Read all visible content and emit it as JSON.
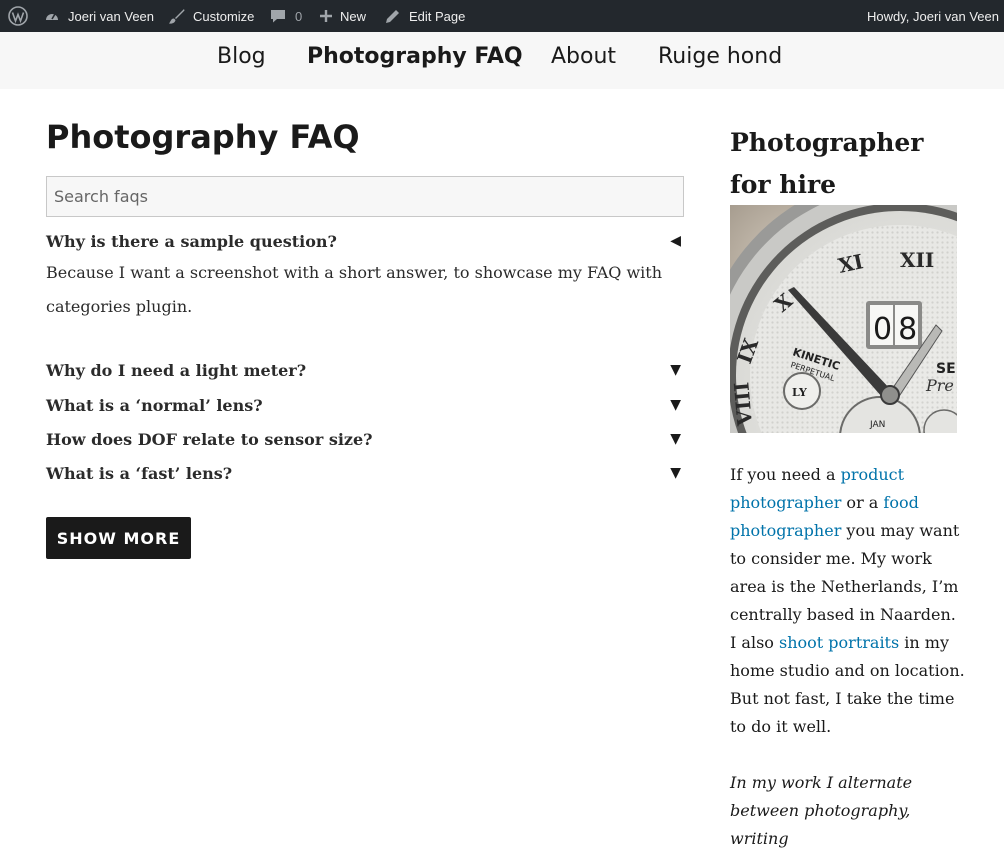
{
  "adminbar": {
    "site_name": "Joeri van Veen",
    "customize": "Customize",
    "comments_count": "0",
    "new": "New",
    "edit_page": "Edit Page",
    "howdy": "Howdy, Joeri van Veen",
    "icons": [
      "wordpress-logo-icon",
      "dashboard-icon",
      "paintbrush-icon",
      "comment-icon",
      "plus-icon",
      "pencil-icon"
    ],
    "background": "#23282d"
  },
  "nav": {
    "items": [
      {
        "label": "Blog"
      },
      {
        "label": "Photography FAQ",
        "active": true
      },
      {
        "label": "About"
      },
      {
        "label": "Ruige hond"
      }
    ]
  },
  "main": {
    "title": "Photography FAQ",
    "search_placeholder": "Search faqs",
    "faqs": [
      {
        "question": "Why is there a sample question?",
        "expanded": true,
        "icon": "◀",
        "answer": "Because I want a screenshot with a short answer, to showcase my FAQ with categories plugin."
      },
      {
        "question": "Why do I need a light meter?",
        "expanded": false,
        "icon": "▼"
      },
      {
        "question": "What is a ‘normal’ lens?",
        "expanded": false,
        "icon": "▼"
      },
      {
        "question": "How does DOF relate to sensor size?",
        "expanded": false,
        "icon": "▼"
      },
      {
        "question": "What is a ‘fast’ lens?",
        "expanded": false,
        "icon": "▼"
      }
    ],
    "show_more": "SHOW MORE"
  },
  "sidebar": {
    "title": "Photographer for hire",
    "watch": {
      "date_window": "08",
      "brand_partial": "SE",
      "script_partial": "Pre",
      "kinetic": "KINETIC",
      "perpetual": "PERPETUAL",
      "month": "JAN",
      "ly": "LY",
      "numerals": [
        "XII",
        "XI",
        "X",
        "IX",
        "VIII"
      ]
    },
    "text": {
      "t1": "If you need a ",
      "link1": "product photographer",
      "t2": " or a ",
      "link2": "food photographer",
      "t3": " you may want to consider me. My work area is the Netherlands, I’m centrally based in Naarden. I also ",
      "link3": "shoot portraits",
      "t4": " in my home studio and on location. But not fast, I take the time to do it well."
    },
    "text2": "In my work I alternate between photography, writing",
    "link_color": "#0073aa"
  }
}
